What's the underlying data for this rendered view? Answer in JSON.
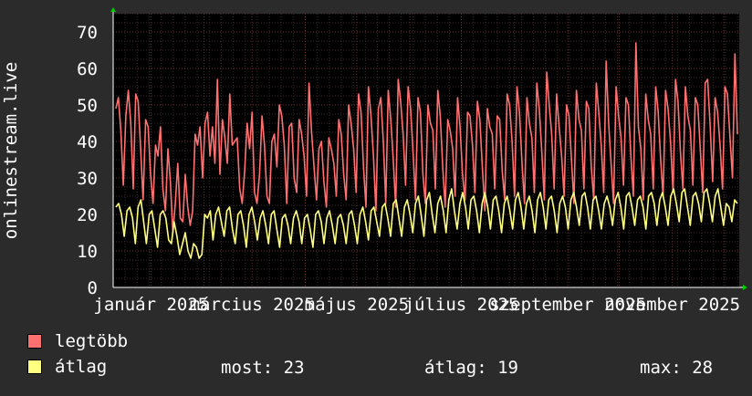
{
  "chart_data": {
    "type": "line",
    "ylabel": "onlinestream.live",
    "ylim": [
      0,
      75
    ],
    "yticks": [
      0,
      10,
      20,
      30,
      40,
      50,
      60,
      70
    ],
    "x_tick_labels": [
      "január 2025",
      "március 2025",
      "május 2025",
      "július 2025",
      "szeptember 2025",
      "november 2025"
    ],
    "x_range": [
      "2024-12-10",
      "2025-12-10"
    ],
    "grid": true,
    "series": [
      {
        "name": "legtöbb",
        "color": "#ff7070",
        "values": [
          49,
          52,
          43,
          28,
          47,
          54,
          45,
          27,
          53,
          51,
          38,
          24,
          46,
          44,
          31,
          23,
          39,
          36,
          44,
          27,
          21,
          38,
          29,
          15,
          23,
          34,
          19,
          18,
          31,
          22,
          17,
          21,
          42,
          39,
          44,
          30,
          45,
          48,
          36,
          44,
          34,
          57,
          31,
          46,
          41,
          34,
          53,
          39,
          40,
          41,
          27,
          23,
          32,
          45,
          38,
          48,
          26,
          23,
          31,
          47,
          39,
          25,
          23,
          40,
          42,
          33,
          50,
          47,
          39,
          23,
          44,
          45,
          30,
          26,
          46,
          42,
          36,
          25,
          56,
          43,
          33,
          24,
          38,
          40,
          29,
          22,
          41,
          38,
          34,
          25,
          46,
          42,
          31,
          24,
          50,
          45,
          38,
          26,
          53,
          48,
          33,
          22,
          55,
          47,
          36,
          21,
          49,
          52,
          40,
          23,
          54,
          46,
          35,
          22,
          57,
          51,
          42,
          28,
          55,
          49,
          37,
          24,
          52,
          48,
          31,
          23,
          50,
          45,
          43,
          27,
          54,
          47,
          33,
          22,
          46,
          43,
          38,
          25,
          52,
          44,
          31,
          24,
          48,
          47,
          39,
          26,
          51,
          46,
          33,
          21,
          49,
          44,
          42,
          27,
          47,
          46,
          32,
          24,
          53,
          50,
          40,
          25,
          55,
          48,
          34,
          23,
          52,
          45,
          41,
          26,
          56,
          49,
          37,
          24,
          59,
          50,
          42,
          27,
          53,
          44,
          36,
          25,
          50,
          47,
          35,
          23,
          54,
          46,
          43,
          27,
          51,
          49,
          33,
          24,
          56,
          48,
          39,
          26,
          62,
          45,
          34,
          23,
          55,
          47,
          41,
          28,
          52,
          50,
          36,
          25,
          67,
          44,
          38,
          24,
          53,
          46,
          42,
          27,
          55,
          48,
          35,
          25,
          54,
          49,
          40,
          26,
          57,
          51,
          37,
          27,
          55,
          47,
          43,
          28,
          52,
          50,
          38,
          26,
          56,
          57,
          44,
          29,
          52,
          48,
          39,
          27,
          55,
          53,
          41,
          30,
          64,
          42
        ]
      },
      {
        "name": "átlag",
        "color": "#ffff80",
        "values": [
          22,
          23,
          20,
          14,
          21,
          22,
          19,
          12,
          22,
          24,
          18,
          12,
          20,
          21,
          16,
          11,
          20,
          21,
          19,
          13,
          12,
          18,
          14,
          9,
          12,
          15,
          10,
          8,
          12,
          11,
          8,
          9,
          20,
          19,
          21,
          13,
          20,
          22,
          18,
          14,
          21,
          22,
          16,
          12,
          20,
          21,
          17,
          11,
          20,
          22,
          18,
          13,
          19,
          21,
          17,
          12,
          20,
          21,
          16,
          11,
          19,
          20,
          17,
          12,
          19,
          21,
          18,
          12,
          19,
          20,
          16,
          11,
          20,
          21,
          18,
          12,
          19,
          21,
          17,
          12,
          19,
          20,
          17,
          12,
          20,
          21,
          17,
          12,
          20,
          22,
          18,
          13,
          21,
          22,
          18,
          14,
          22,
          23,
          19,
          14,
          23,
          24,
          19,
          14,
          22,
          24,
          20,
          15,
          23,
          25,
          20,
          14,
          24,
          26,
          20,
          15,
          23,
          25,
          21,
          15,
          24,
          27,
          21,
          16,
          23,
          26,
          22,
          16,
          24,
          25,
          21,
          15,
          23,
          26,
          22,
          16,
          24,
          25,
          21,
          15,
          23,
          25,
          21,
          16,
          24,
          26,
          22,
          16,
          23,
          25,
          21,
          15,
          24,
          26,
          22,
          16,
          24,
          25,
          21,
          15,
          23,
          25,
          22,
          16,
          24,
          26,
          22,
          17,
          25,
          26,
          22,
          16,
          24,
          25,
          21,
          16,
          23,
          25,
          22,
          17,
          24,
          26,
          22,
          16,
          25,
          26,
          22,
          17,
          24,
          25,
          22,
          16,
          25,
          26,
          23,
          17,
          24,
          26,
          22,
          17,
          25,
          27,
          23,
          18,
          26,
          27,
          22,
          17,
          25,
          26,
          23,
          18,
          26,
          27,
          23,
          18,
          25,
          27,
          22,
          17,
          23,
          22,
          18,
          24,
          23
        ]
      }
    ]
  },
  "legend": [
    {
      "label": "legtöbb",
      "color": "#ff7070"
    },
    {
      "label": "átlag",
      "color": "#ffff80"
    }
  ],
  "stats": {
    "most": "most: 23",
    "atlag": "átlag: 19",
    "max": "max: 28"
  }
}
